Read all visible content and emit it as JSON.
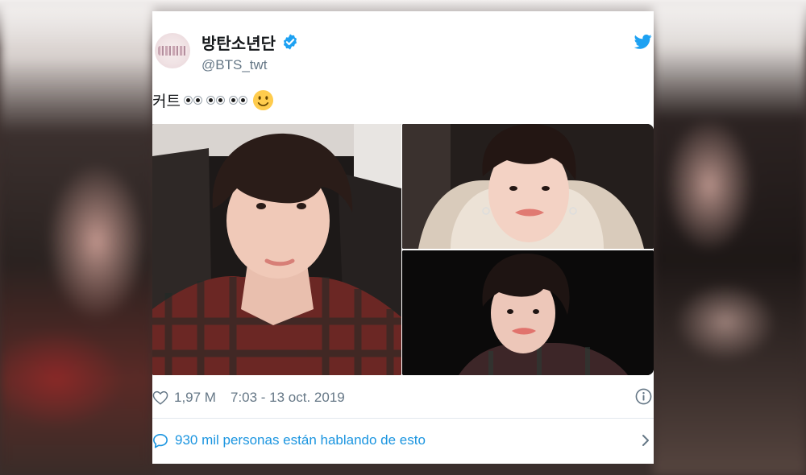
{
  "tweet": {
    "display_name": "방탄소년단",
    "handle": "@BTS_twt",
    "text": "커트",
    "likes": "1,97 M",
    "timestamp": "7:03 - 13 oct. 2019",
    "conversation_link": "930 mil personas están hablando de esto"
  },
  "icons": {
    "verified": "verified-badge-icon",
    "brand": "twitter-bird-icon",
    "like": "heart-icon",
    "info": "info-icon",
    "reply": "speech-bubble-icon",
    "more": "chevron-right-icon",
    "emoji_eyes": "eyes-emoji",
    "emoji_smile": "slightly-smiling-face-emoji"
  },
  "colors": {
    "twitter_blue": "#1da1f2",
    "link_blue": "#1b95e0",
    "text_primary": "#14171a",
    "text_secondary": "#657786"
  }
}
